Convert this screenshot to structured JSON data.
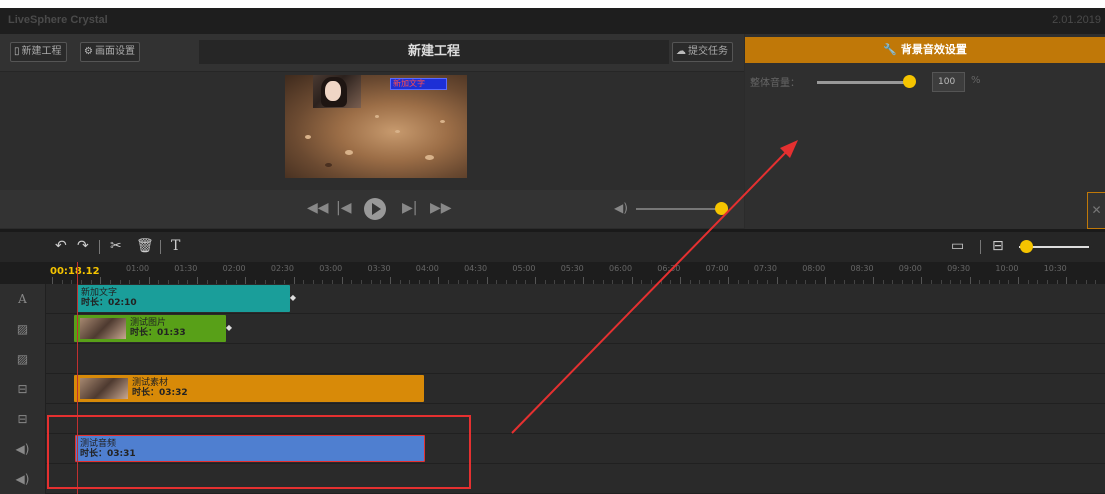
{
  "window": {
    "title": "LiveSphere Crystal",
    "version": "2.01.2019"
  },
  "toolbar": {
    "new_project": "新建工程",
    "screen_settings": "画面设置",
    "project_title": "新建工程",
    "submit_task": "提交任务"
  },
  "right_panel": {
    "header": "背景音效设置",
    "volume_label": "整体音量：",
    "volume_value": "100",
    "volume_unit": "%",
    "volume_level": 1.0
  },
  "player": {
    "volume_level": 0.92
  },
  "timeline": {
    "current_time": "00:18.12",
    "ticks": [
      "01:00",
      "01:30",
      "02:00",
      "02:30",
      "03:00",
      "03:30",
      "04:00",
      "04:30",
      "05:00",
      "05:30",
      "06:00",
      "06:30",
      "07:00",
      "07:30",
      "08:00",
      "08:30",
      "09:00",
      "09:30",
      "10:00",
      "10:30"
    ],
    "zoom_level": 0.1,
    "tracks": [
      {
        "type": "text",
        "icon": "A"
      },
      {
        "type": "image",
        "icon": "image-icon"
      },
      {
        "type": "image",
        "icon": "image-icon"
      },
      {
        "type": "video",
        "icon": "film-icon"
      },
      {
        "type": "video",
        "icon": "film-icon"
      },
      {
        "type": "audio",
        "icon": "speaker-icon"
      },
      {
        "type": "audio",
        "icon": "speaker-icon"
      }
    ],
    "clips": {
      "text": {
        "name": "新加文字",
        "duration": "时长：02:10",
        "color": "#1a9e9a"
      },
      "image": {
        "name": "测试图片",
        "duration": "时长：01:33",
        "color": "#58a018"
      },
      "video": {
        "name": "测试素材",
        "duration": "时长：03:32",
        "color": "#d88a08"
      },
      "audio": {
        "name": "测试音频",
        "duration": "时长：03:31",
        "color": "#4f7fd0"
      }
    }
  },
  "preview": {
    "overlay_text": "新加文字"
  },
  "colors": {
    "accent": "#c07808",
    "knob": "#f5c400",
    "annotation": "#e53030"
  }
}
